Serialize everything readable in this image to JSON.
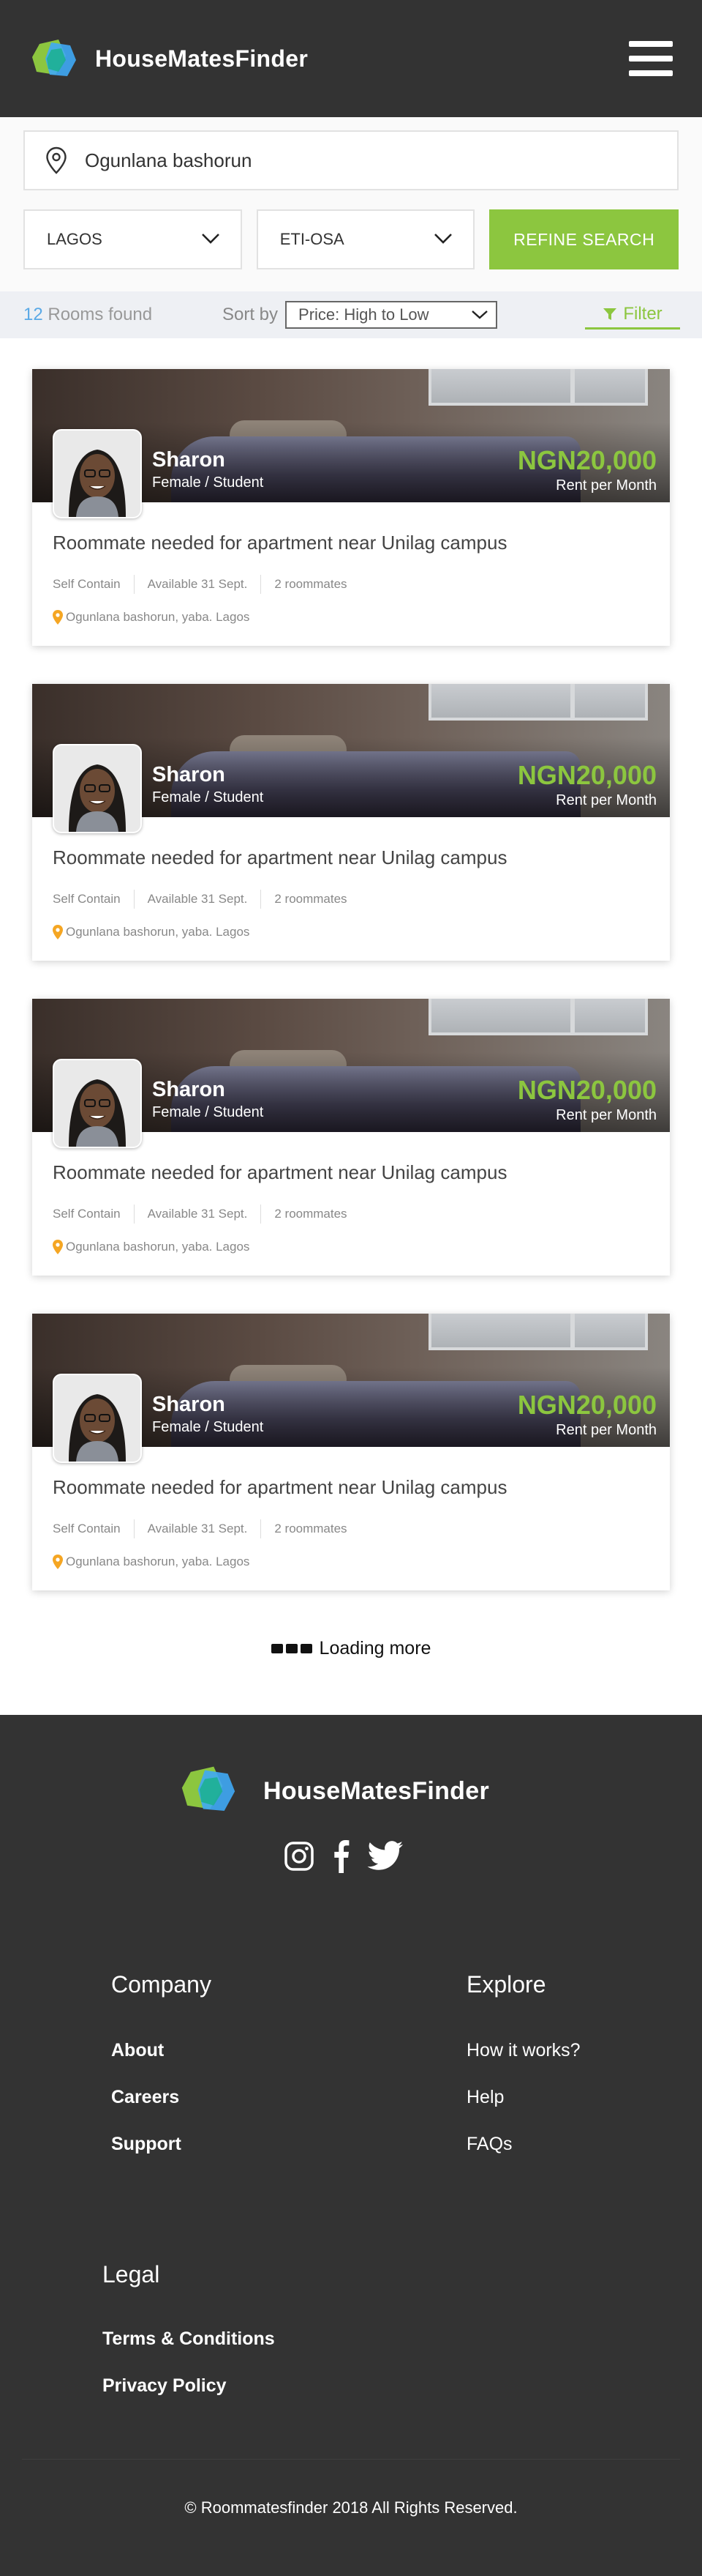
{
  "header": {
    "brand_name": "HouseMatesFinder",
    "logo_colors": [
      "#8cc63f",
      "#3fa9f5",
      "#1bb08e"
    ]
  },
  "search": {
    "location_value": "Ogunlana bashorun",
    "state_value": "LAGOS",
    "lga_value": "ETI-OSA",
    "refine_label": "REFINE SEARCH"
  },
  "results": {
    "count": "12",
    "count_suffix": "Rooms found",
    "sort_label": "Sort by",
    "sort_value": "Price: High to Low",
    "filter_label": "Filter"
  },
  "listings": [
    {
      "name": "Sharon",
      "role": "Female / Student",
      "price": "NGN20,000",
      "period": "Rent per Month",
      "title": "Roommate needed for apartment near Unilag campus",
      "type": "Self Contain",
      "available": "Available 31 Sept.",
      "roommates": "2 roommates",
      "address": "Ogunlana bashorun, yaba. Lagos"
    },
    {
      "name": "Sharon",
      "role": "Female / Student",
      "price": "NGN20,000",
      "period": "Rent per Month",
      "title": "Roommate needed for apartment near Unilag campus",
      "type": "Self Contain",
      "available": "Available 31 Sept.",
      "roommates": "2 roommates",
      "address": "Ogunlana bashorun, yaba. Lagos"
    },
    {
      "name": "Sharon",
      "role": "Female / Student",
      "price": "NGN20,000",
      "period": "Rent per Month",
      "title": "Roommate needed for apartment near Unilag campus",
      "type": "Self Contain",
      "available": "Available 31 Sept.",
      "roommates": "2 roommates",
      "address": "Ogunlana bashorun, yaba. Lagos"
    },
    {
      "name": "Sharon",
      "role": "Female / Student",
      "price": "NGN20,000",
      "period": "Rent per Month",
      "title": "Roommate needed for apartment near Unilag campus",
      "type": "Self Contain",
      "available": "Available 31 Sept.",
      "roommates": "2 roommates",
      "address": "Ogunlana bashorun, yaba. Lagos"
    }
  ],
  "loading_label": "Loading more",
  "footer": {
    "brand_name": "HouseMatesFinder",
    "social": [
      "instagram-icon",
      "facebook-icon",
      "twitter-icon"
    ],
    "company": {
      "title": "Company",
      "links": [
        "About",
        "Careers",
        "Support"
      ]
    },
    "explore": {
      "title": "Explore",
      "links": [
        "How it works?",
        "Help",
        "FAQs"
      ]
    },
    "legal": {
      "title": "Legal",
      "links": [
        "Terms & Conditions",
        "Privacy Policy"
      ]
    },
    "copyright": "© Roommatesfinder 2018 All Rights Reserved."
  },
  "colors": {
    "header_bg": "#333333",
    "accent_green": "#8cc63f",
    "count_blue": "#5aa9e6",
    "pin_orange": "#f5a623"
  }
}
